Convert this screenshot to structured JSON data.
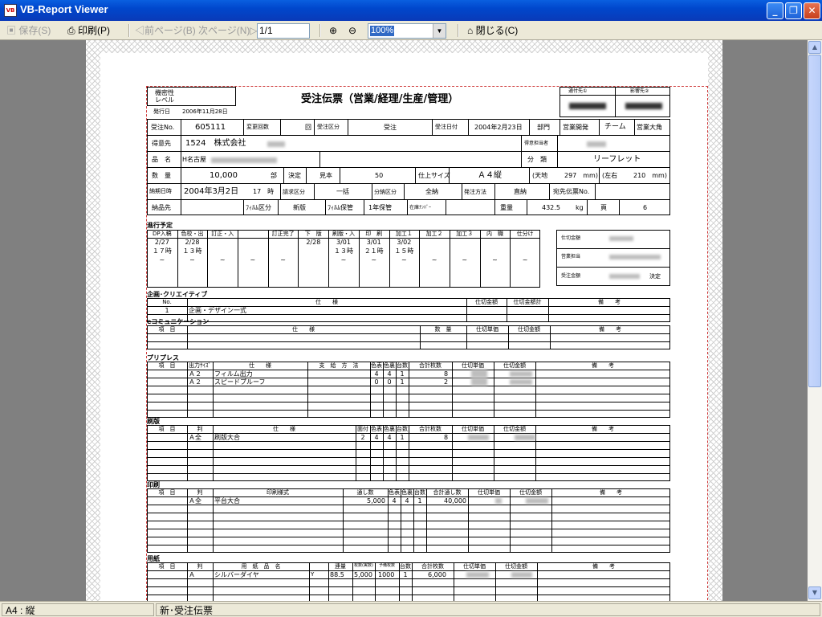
{
  "window": {
    "title": "VB-Report Viewer"
  },
  "toolbar": {
    "save": "保存(S)",
    "print": "印刷(P)",
    "prev": "前ページ(B)",
    "next": "次ページ(N)",
    "page": "1/1",
    "zoom": "100%",
    "close": "閉じる(C)"
  },
  "status": {
    "paper": "A4 : 縦",
    "doc": "新･受注伝票"
  },
  "report": {
    "title": "受注伝票（営業/経理/生産/管理）",
    "label_box_l1": "機密性",
    "label_box_l2": "レベル",
    "issue_label": "発行日",
    "issue_date": "2006年11月28日",
    "tantou1": "通付先①",
    "tantou2": "影響先②",
    "r1": {
      "l1": "受注No.",
      "v1": "605111",
      "l2": "変更回数",
      "v2": "回",
      "l3": "受注区分",
      "v3": "受注",
      "l4": "受注日付",
      "v4": "2004年2月23日",
      "l5": "部門",
      "v5a": "営業開発",
      "v5b": "チーム",
      "v5c": "営業大角"
    },
    "r2": {
      "l1": "得意先",
      "v1": "1524　株式会社",
      "l2": "得意担当者"
    },
    "r3": {
      "l1": "品　名",
      "v1": "H名古屋",
      "l2": "分　類",
      "v2": "リーフレット"
    },
    "r4": {
      "l1": "数　量",
      "v1": "10,000",
      "u1": "部",
      "l2": "決定",
      "l3": "見本",
      "v3": "50",
      "l4": "仕上サイズ",
      "v4": "Ａ４縦",
      "l5": "(天地",
      "v5": "297　mm)",
      "l6": "(左右",
      "v6": "210　mm)"
    },
    "r5": {
      "l1": "納期日時",
      "v1": "2004年3月2日",
      "v1b": "17　時",
      "l2": "請求区分",
      "v2": "一括",
      "l3": "分納区分",
      "v3": "全納",
      "l4": "発注方法",
      "v4": "直納",
      "l5": "宛先伝票No."
    },
    "r6": {
      "l1": "納品先",
      "l2": "ﾌｨﾙﾑ区分",
      "v2": "新版",
      "l3": "ﾌｨﾙﾑ保管",
      "v3": "1年保管",
      "l4": "在庫ﾅﾝﾊﾞｰ",
      "l5": "重量",
      "v5": "432.5",
      "u5": "kg",
      "l6": "頁",
      "v6": "6"
    },
    "sched": {
      "title": "進行予定",
      "heads": [
        "DP入稿",
        "色校・出",
        "訂正・入",
        "",
        "訂正完了",
        "下　版",
        "刷版・入",
        "印　刷",
        "加工１",
        "加工２",
        "加工３",
        "内　職",
        "仕分け"
      ],
      "dates": [
        "2/27",
        "2/28",
        "",
        "",
        "",
        "2/28",
        "3/01",
        "3/01",
        "3/02",
        "",
        "",
        "",
        ""
      ],
      "times": [
        "１７時",
        "１３時",
        "",
        "",
        "",
        "",
        "１３時",
        "２１時",
        "１５時",
        "",
        "",
        "",
        ""
      ],
      "side": [
        "仕切金額",
        "営業担当",
        "受注金額"
      ],
      "decide": "決定"
    },
    "planning": {
      "title": "企画･クリエイティブ",
      "heads": [
        "No.",
        "仕　　様",
        "仕切金額",
        "仕切金額計",
        "備　　考"
      ],
      "row": [
        "1",
        "企画・デザイン一式"
      ]
    },
    "comm": {
      "title": "eコミュニケーション",
      "heads": [
        "項　目",
        "仕　　様",
        "数　量",
        "仕切単価",
        "仕切金額",
        "備　　考"
      ]
    },
    "prepress": {
      "title": "プリプレス",
      "heads": [
        "項　目",
        "出力ｻｲｽﾞ",
        "仕　　様",
        "支　給　方　法",
        "色表",
        "色裏",
        "台数",
        "合計枚数",
        "仕切単価",
        "仕切金額",
        "備　　考"
      ],
      "rows": [
        [
          "Ａ２",
          "フィルム出力",
          "4",
          "4",
          "1",
          "8"
        ],
        [
          "Ａ２",
          "スピードプルーフ",
          "0",
          "0",
          "1",
          "2"
        ]
      ]
    },
    "plate": {
      "title": "刷版",
      "heads": [
        "項　目",
        "判",
        "仕　　様",
        "面付",
        "色表",
        "色裏",
        "台数",
        "合計枚数",
        "仕切単価",
        "仕切金額",
        "備　　考"
      ],
      "row": [
        "Ａ全",
        "刷版大合",
        "2",
        "4",
        "4",
        "1",
        "8"
      ]
    },
    "press": {
      "title": "印刷",
      "heads": [
        "項　目",
        "判",
        "印刷様式",
        "通し数",
        "色表",
        "色裏",
        "台数",
        "合計通し数",
        "仕切単価",
        "仕切金額",
        "備　　考"
      ],
      "row": [
        "Ａ全",
        "平台大合",
        "5,000",
        "4",
        "4",
        "1",
        "40,000"
      ]
    },
    "paper": {
      "title": "用紙",
      "heads": [
        "項　目",
        "判",
        "用　紙　品　名",
        "連量",
        "枚数(実数)",
        "予備枚数",
        "台数",
        "合計枚数",
        "仕切単価",
        "仕切金額",
        "備　　考"
      ],
      "row": [
        "Ａ",
        "シルバーダイヤ",
        "Y",
        "88.5",
        "5,000",
        "1000",
        "1",
        "6,000"
      ]
    }
  }
}
